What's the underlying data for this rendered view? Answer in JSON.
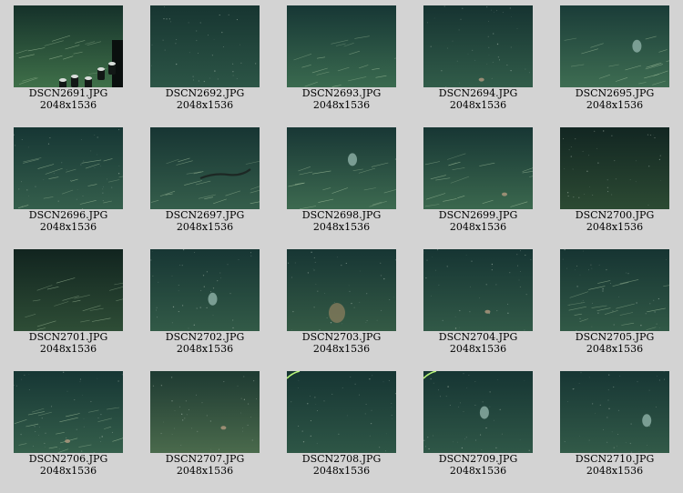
{
  "gallery": {
    "items": [
      {
        "filename": "DSCN2691.JPG",
        "dimensions": "2048x1536",
        "tone": "bright",
        "top_color": "#15312a",
        "bottom_color": "#3f7049",
        "features": [
          "instrument-frame",
          "stalks"
        ]
      },
      {
        "filename": "DSCN2692.JPG",
        "dimensions": "2048x1536",
        "tone": "medium",
        "top_color": "#173531",
        "bottom_color": "#2c5546",
        "features": [
          "specks"
        ]
      },
      {
        "filename": "DSCN2693.JPG",
        "dimensions": "2048x1536",
        "tone": "medium",
        "top_color": "#173735",
        "bottom_color": "#3a6a4f",
        "features": [
          "stalks"
        ]
      },
      {
        "filename": "DSCN2694.JPG",
        "dimensions": "2048x1536",
        "tone": "medium",
        "top_color": "#163331",
        "bottom_color": "#315c49",
        "features": [
          "specks",
          "small-creature"
        ]
      },
      {
        "filename": "DSCN2695.JPG",
        "dimensions": "2048x1536",
        "tone": "medium",
        "top_color": "#1a3c38",
        "bottom_color": "#3e6d52",
        "features": [
          "stalks",
          "pale-creature"
        ]
      },
      {
        "filename": "DSCN2696.JPG",
        "dimensions": "2048x1536",
        "tone": "medium",
        "top_color": "#163634",
        "bottom_color": "#355f4c",
        "features": [
          "specks",
          "stalks"
        ]
      },
      {
        "filename": "DSCN2697.JPG",
        "dimensions": "2048x1536",
        "tone": "medium",
        "top_color": "#173533",
        "bottom_color": "#355e4b",
        "features": [
          "stalks",
          "dark-eel"
        ]
      },
      {
        "filename": "DSCN2698.JPG",
        "dimensions": "2048x1536",
        "tone": "medium",
        "top_color": "#183735",
        "bottom_color": "#3d6a50",
        "features": [
          "stalks",
          "pale-creature"
        ]
      },
      {
        "filename": "DSCN2699.JPG",
        "dimensions": "2048x1536",
        "tone": "medium",
        "top_color": "#173634",
        "bottom_color": "#3b684e",
        "features": [
          "stalks",
          "small-creature"
        ]
      },
      {
        "filename": "DSCN2700.JPG",
        "dimensions": "2048x1536",
        "tone": "dark",
        "top_color": "#122622",
        "bottom_color": "#2c4a33",
        "features": [
          "specks"
        ]
      },
      {
        "filename": "DSCN2701.JPG",
        "dimensions": "2048x1536",
        "tone": "dark",
        "top_color": "#11241f",
        "bottom_color": "#2e4d36",
        "features": [
          "stalks"
        ]
      },
      {
        "filename": "DSCN2702.JPG",
        "dimensions": "2048x1536",
        "tone": "medium",
        "top_color": "#173634",
        "bottom_color": "#325a47",
        "features": [
          "specks",
          "pale-creature"
        ]
      },
      {
        "filename": "DSCN2703.JPG",
        "dimensions": "2048x1536",
        "tone": "medium",
        "top_color": "#173634",
        "bottom_color": "#345a45",
        "features": [
          "specks",
          "brown-creature"
        ]
      },
      {
        "filename": "DSCN2704.JPG",
        "dimensions": "2048x1536",
        "tone": "medium",
        "top_color": "#163533",
        "bottom_color": "#315947",
        "features": [
          "specks",
          "small-creature"
        ]
      },
      {
        "filename": "DSCN2705.JPG",
        "dimensions": "2048x1536",
        "tone": "medium",
        "top_color": "#163432",
        "bottom_color": "#315946",
        "features": [
          "specks",
          "stalks"
        ]
      },
      {
        "filename": "DSCN2706.JPG",
        "dimensions": "2048x1536",
        "tone": "medium",
        "top_color": "#163634",
        "bottom_color": "#355f4b",
        "features": [
          "specks",
          "stalks",
          "small-creature"
        ]
      },
      {
        "filename": "DSCN2707.JPG",
        "dimensions": "2048x1536",
        "tone": "murky",
        "top_color": "#1e3a32",
        "bottom_color": "#4a6a4c",
        "features": [
          "specks",
          "small-creature"
        ]
      },
      {
        "filename": "DSCN2708.JPG",
        "dimensions": "2048x1536",
        "tone": "medium",
        "top_color": "#163533",
        "bottom_color": "#2e5646",
        "features": [
          "specks",
          "light-arc"
        ]
      },
      {
        "filename": "DSCN2709.JPG",
        "dimensions": "2048x1536",
        "tone": "medium",
        "top_color": "#163533",
        "bottom_color": "#2f5747",
        "features": [
          "specks",
          "light-arc",
          "pale-creature"
        ]
      },
      {
        "filename": "DSCN2710.JPG",
        "dimensions": "2048x1536",
        "tone": "medium",
        "top_color": "#173634",
        "bottom_color": "#325a48",
        "features": [
          "specks",
          "pale-creature"
        ]
      }
    ]
  }
}
